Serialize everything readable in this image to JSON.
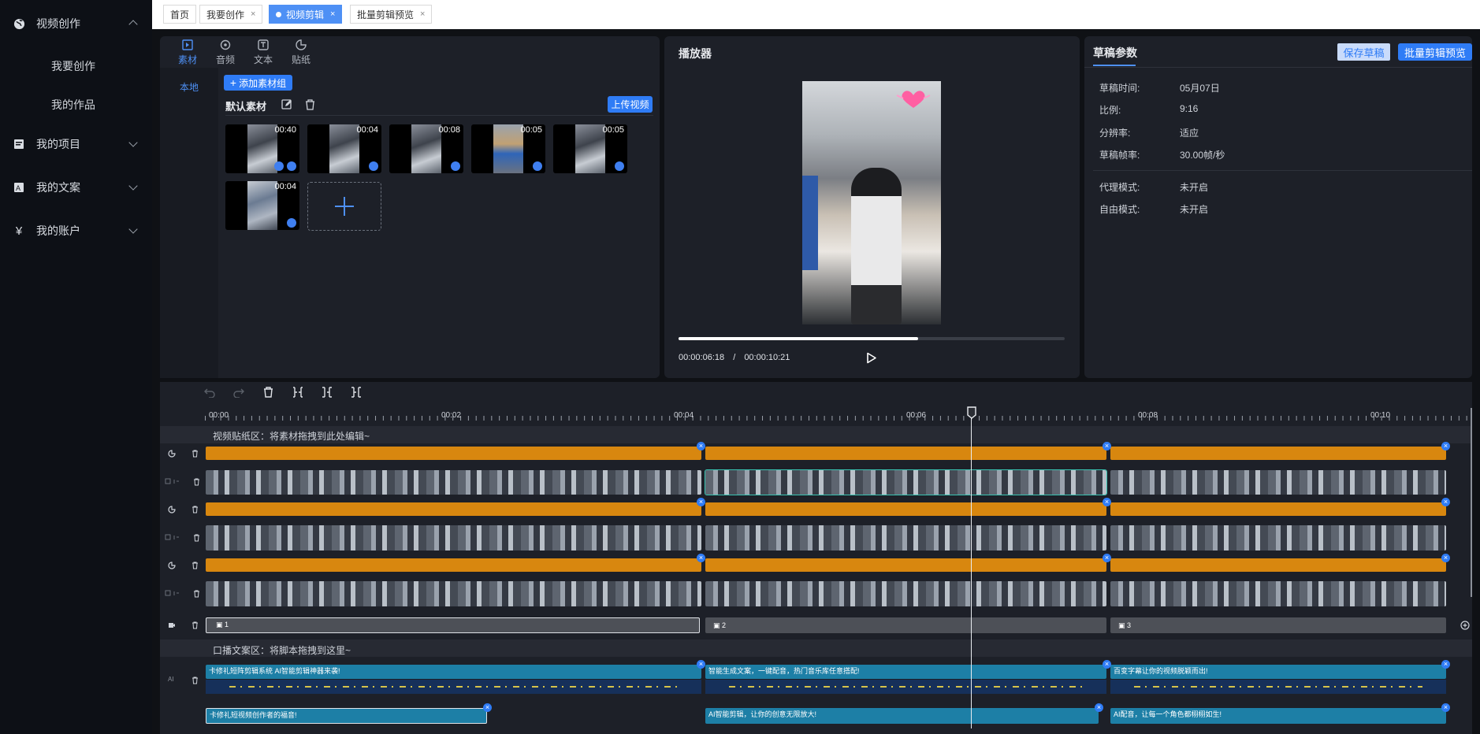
{
  "sidebar": {
    "groups": [
      {
        "label": "视频创作",
        "icon": "globe-icon",
        "expanded": true,
        "items": [
          "我要创作",
          "我的作品"
        ]
      },
      {
        "label": "我的项目",
        "icon": "project-icon",
        "expanded": false
      },
      {
        "label": "我的文案",
        "icon": "copywriting-icon",
        "expanded": false
      },
      {
        "label": "我的账户",
        "icon": "yen-icon",
        "expanded": false
      }
    ]
  },
  "tabs": [
    {
      "label": "首页"
    },
    {
      "label": "我要创作",
      "close": "×"
    },
    {
      "label": "视频剪辑",
      "close": "×",
      "active": true
    },
    {
      "label": "批量剪辑预览",
      "close": "×"
    }
  ],
  "material": {
    "tabs": [
      "素材",
      "音频",
      "文本",
      "贴纸"
    ],
    "side_tab": "本地",
    "add_group_button": "添加素材组",
    "group_title": "默认素材",
    "upload_button": "上传视频",
    "thumbs": [
      "00:40",
      "00:04",
      "00:08",
      "00:05",
      "00:05",
      "00:04"
    ],
    "add_icon": "plus-icon"
  },
  "player": {
    "title": "播放器",
    "current_time": "00:00:06:18",
    "separator": "/",
    "total_time": "00:00:10:21",
    "progress": 0.62
  },
  "draft": {
    "title": "草稿参数",
    "save_button": "保存草稿",
    "batch_button": "批量剪辑预览",
    "props": [
      {
        "k": "草稿时间:",
        "v": "05月07日"
      },
      {
        "k": "比例:",
        "v": "9:16"
      },
      {
        "k": "分辨率:",
        "v": "适应"
      },
      {
        "k": "草稿帧率:",
        "v": "30.00帧/秒"
      },
      {
        "k": "代理模式:",
        "v": "未开启"
      },
      {
        "k": "自由模式:",
        "v": "未开启"
      }
    ]
  },
  "timeline": {
    "ticks": [
      "00:00",
      "00:02",
      "00:04",
      "00:06",
      "00:08",
      "00:10"
    ],
    "sticker_zone": "视频贴纸区：将素材拖拽到此处编辑~",
    "script_zone": "口播文案区：将脚本拖拽到这里~",
    "scene_labels": [
      "1",
      "2",
      "3"
    ],
    "script_row1": [
      "卡修礼短阵剪辑系统 AI智能剪辑神器来袭!",
      "智能生成文案，一键配音，热门音乐库任意搭配!",
      "百变字幕让你的视频脱颖而出!"
    ],
    "script_row2": [
      "卡修礼短视频创作者的福音!",
      "AI智能剪辑，让你的创意无限放大!",
      "AI配音，让每一个角色都栩栩如生!"
    ]
  }
}
